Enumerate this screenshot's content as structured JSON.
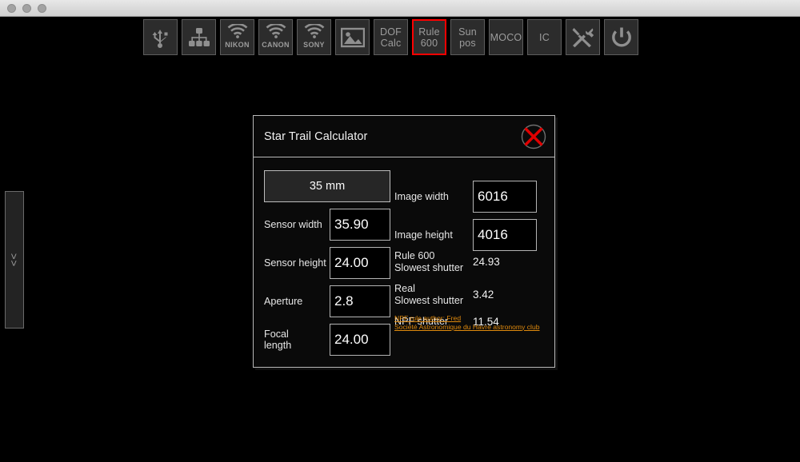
{
  "window": {
    "traffic_lights": [
      "close",
      "minimize",
      "zoom"
    ]
  },
  "drawer": {
    "expand_label": ">>"
  },
  "toolbar": {
    "buttons": [
      {
        "name": "usb",
        "icon": "usb-icon",
        "label": "",
        "wordmark": "",
        "active": false
      },
      {
        "name": "network",
        "icon": "network-icon",
        "label": "",
        "wordmark": "",
        "active": false
      },
      {
        "name": "nikon-wifi",
        "icon": "wifi-icon",
        "label": "",
        "wordmark": "NIKON",
        "active": false
      },
      {
        "name": "canon-wifi",
        "icon": "wifi-icon",
        "label": "",
        "wordmark": "CANON",
        "active": false
      },
      {
        "name": "sony-wifi",
        "icon": "wifi-icon",
        "label": "",
        "wordmark": "SONY",
        "active": false
      },
      {
        "name": "gallery",
        "icon": "picture-icon",
        "label": "",
        "wordmark": "",
        "active": false
      },
      {
        "name": "dof-calc",
        "icon": "",
        "label": "DOF\nCalc",
        "wordmark": "",
        "active": false
      },
      {
        "name": "rule-600",
        "icon": "",
        "label": "Rule\n600",
        "wordmark": "",
        "active": true
      },
      {
        "name": "sun-pos",
        "icon": "",
        "label": "Sun\npos",
        "wordmark": "",
        "active": false
      },
      {
        "name": "moco",
        "icon": "",
        "label": "MOCO",
        "wordmark": "",
        "active": false
      },
      {
        "name": "ic",
        "icon": "",
        "label": "IC",
        "wordmark": "",
        "active": false
      },
      {
        "name": "tools",
        "icon": "tools-icon",
        "label": "",
        "wordmark": "",
        "active": false
      },
      {
        "name": "power",
        "icon": "power-icon",
        "label": "",
        "wordmark": "",
        "active": false
      }
    ]
  },
  "dialog": {
    "title": "Star Trail Calculator",
    "close_icon": "close-circle-icon",
    "preset_button": "35 mm",
    "left_fields": [
      {
        "label": "Sensor width",
        "value": "35.90"
      },
      {
        "label": "Sensor height",
        "value": "24.00"
      },
      {
        "label": "Aperture",
        "value": "2.8"
      },
      {
        "label": "Focal\nlength",
        "value": "24.00"
      }
    ],
    "right_inputs": [
      {
        "label": "Image width",
        "value": "6016"
      },
      {
        "label": "Image height",
        "value": "4016"
      }
    ],
    "results": [
      {
        "label": "Rule 600\nSlowest shutter",
        "value": "24.93"
      },
      {
        "label": "Real\nSlowest shutter",
        "value": "3.42"
      },
      {
        "label": "NPF shutter",
        "value": "11.54"
      }
    ],
    "credit": {
      "line1": "NPF rule author: Fred",
      "line2": "Société Astronomique du Havre astronomy club"
    }
  },
  "colors": {
    "accent_red": "#ff0000",
    "link_orange": "#e08a0d",
    "panel_bg": "#0a0a0a",
    "border_gray": "#b9b9b9"
  }
}
